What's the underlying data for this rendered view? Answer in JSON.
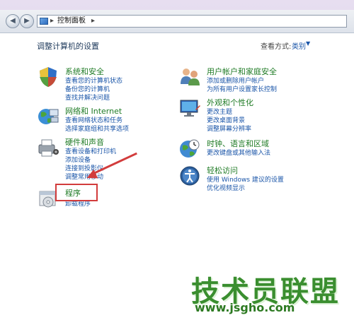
{
  "address": {
    "crumb": "控制面板",
    "sep": "▸"
  },
  "page_title": "调整计算机的设置",
  "view": {
    "label": "查看方式:",
    "value": "类别",
    "arrow": "▼"
  },
  "categories": [
    {
      "title": "系统和安全",
      "links": [
        "查看您的计算机状态",
        "备份您的计算机",
        "查找并解决问题"
      ]
    },
    {
      "title": "网络和 Internet",
      "links": [
        "查看网络状态和任务",
        "选择家庭组和共享选项"
      ]
    },
    {
      "title": "硬件和声音",
      "links": [
        "查看设备和打印机",
        "添加设备",
        "连接到投影仪",
        "调整常用移动"
      ]
    },
    {
      "title": "程序",
      "links": [
        "卸载程序"
      ]
    },
    {
      "title": "用户帐户和家庭安全",
      "links": [
        "添加或删除用户帐户",
        "为所有用户设置家长控制"
      ]
    },
    {
      "title": "外观和个性化",
      "links": [
        "更改主题",
        "更改桌面背景",
        "调整屏幕分辨率"
      ]
    },
    {
      "title": "时钟、语言和区域",
      "links": [
        "更改键盘或其他输入法"
      ]
    },
    {
      "title": "轻松访问",
      "links": [
        "使用 Windows 建议的设置",
        "优化视频显示"
      ]
    }
  ],
  "watermark": {
    "text": "技术员联盟",
    "url": "www.jsgho.com"
  },
  "colors": {
    "title_green": "#1f7b25",
    "link_blue": "#1a55a8",
    "annotation_red": "#d23c3c"
  }
}
